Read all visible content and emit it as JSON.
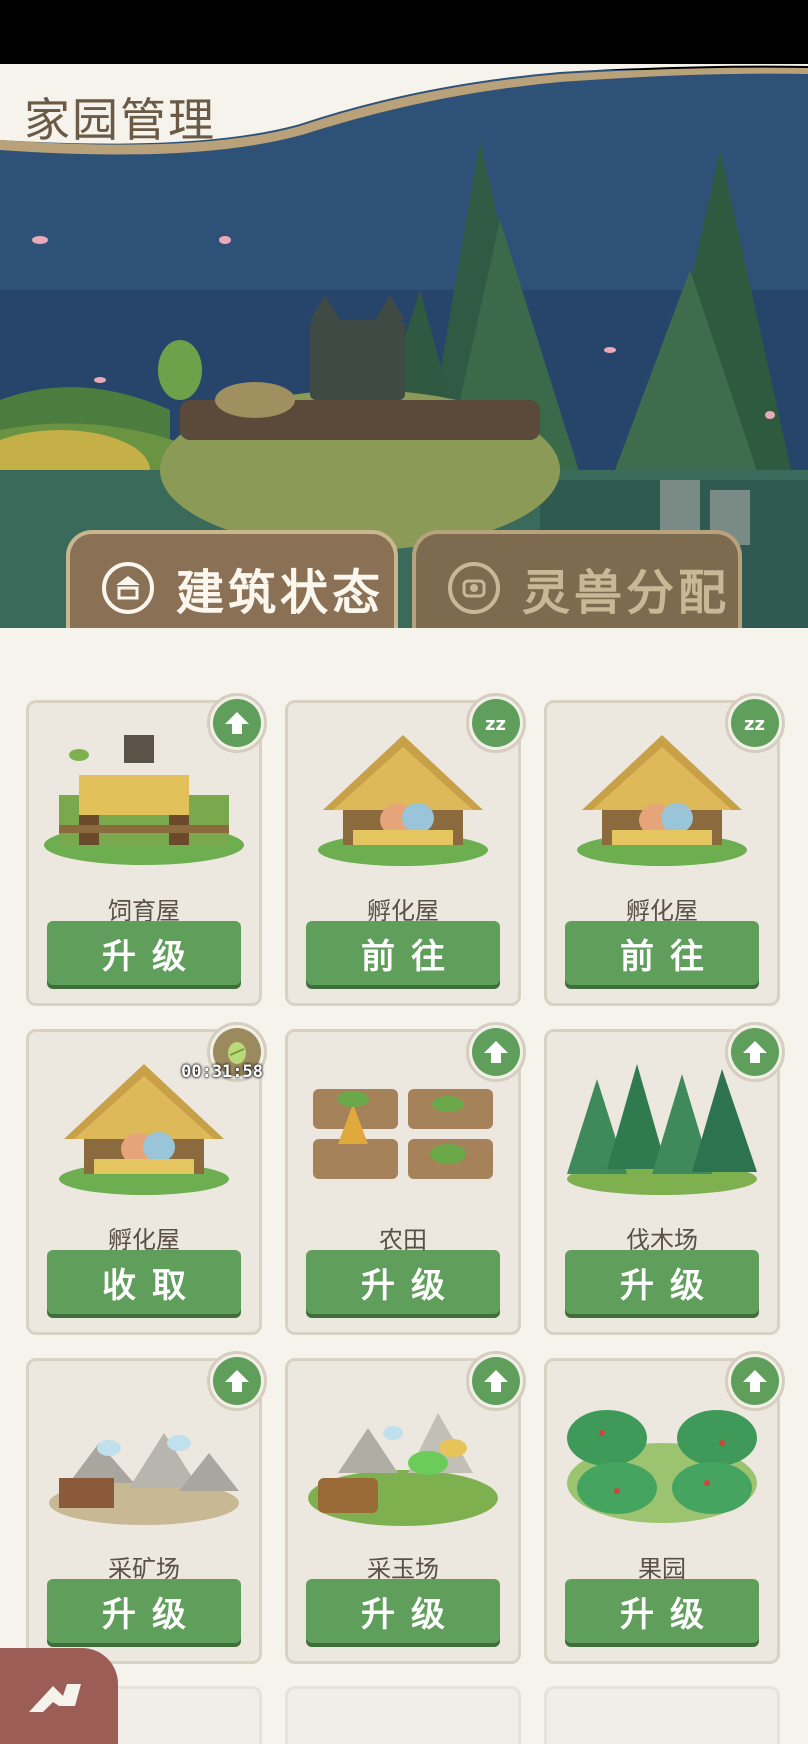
{
  "header": {
    "title": "家园管理"
  },
  "tabs": [
    {
      "label": "建筑状态",
      "active": true,
      "icon": "building-icon"
    },
    {
      "label": "灵兽分配",
      "active": false,
      "icon": "beast-icon"
    }
  ],
  "buildings": [
    {
      "name": "饲育屋",
      "button": "升级",
      "badge": "upgrade-arrow-icon"
    },
    {
      "name": "孵化屋",
      "button": "前往",
      "badge": "sleep-icon"
    },
    {
      "name": "孵化屋",
      "button": "前往",
      "badge": "sleep-icon"
    },
    {
      "name": "孵化屋",
      "button": "收取",
      "badge": "egg-icon",
      "timer": "00:31:58"
    },
    {
      "name": "农田",
      "button": "升级",
      "badge": "upgrade-arrow-icon"
    },
    {
      "name": "伐木场",
      "button": "升级",
      "badge": "upgrade-arrow-icon"
    },
    {
      "name": "采矿场",
      "button": "升级",
      "badge": "upgrade-arrow-icon"
    },
    {
      "name": "采玉场",
      "button": "升级",
      "badge": "upgrade-arrow-icon"
    },
    {
      "name": "果园",
      "button": "升级",
      "badge": "upgrade-arrow-icon"
    }
  ],
  "colors": {
    "accent_green": "#5f9e5b",
    "tab_brown": "#8a7155",
    "panel_bg": "#f6f3ec"
  }
}
